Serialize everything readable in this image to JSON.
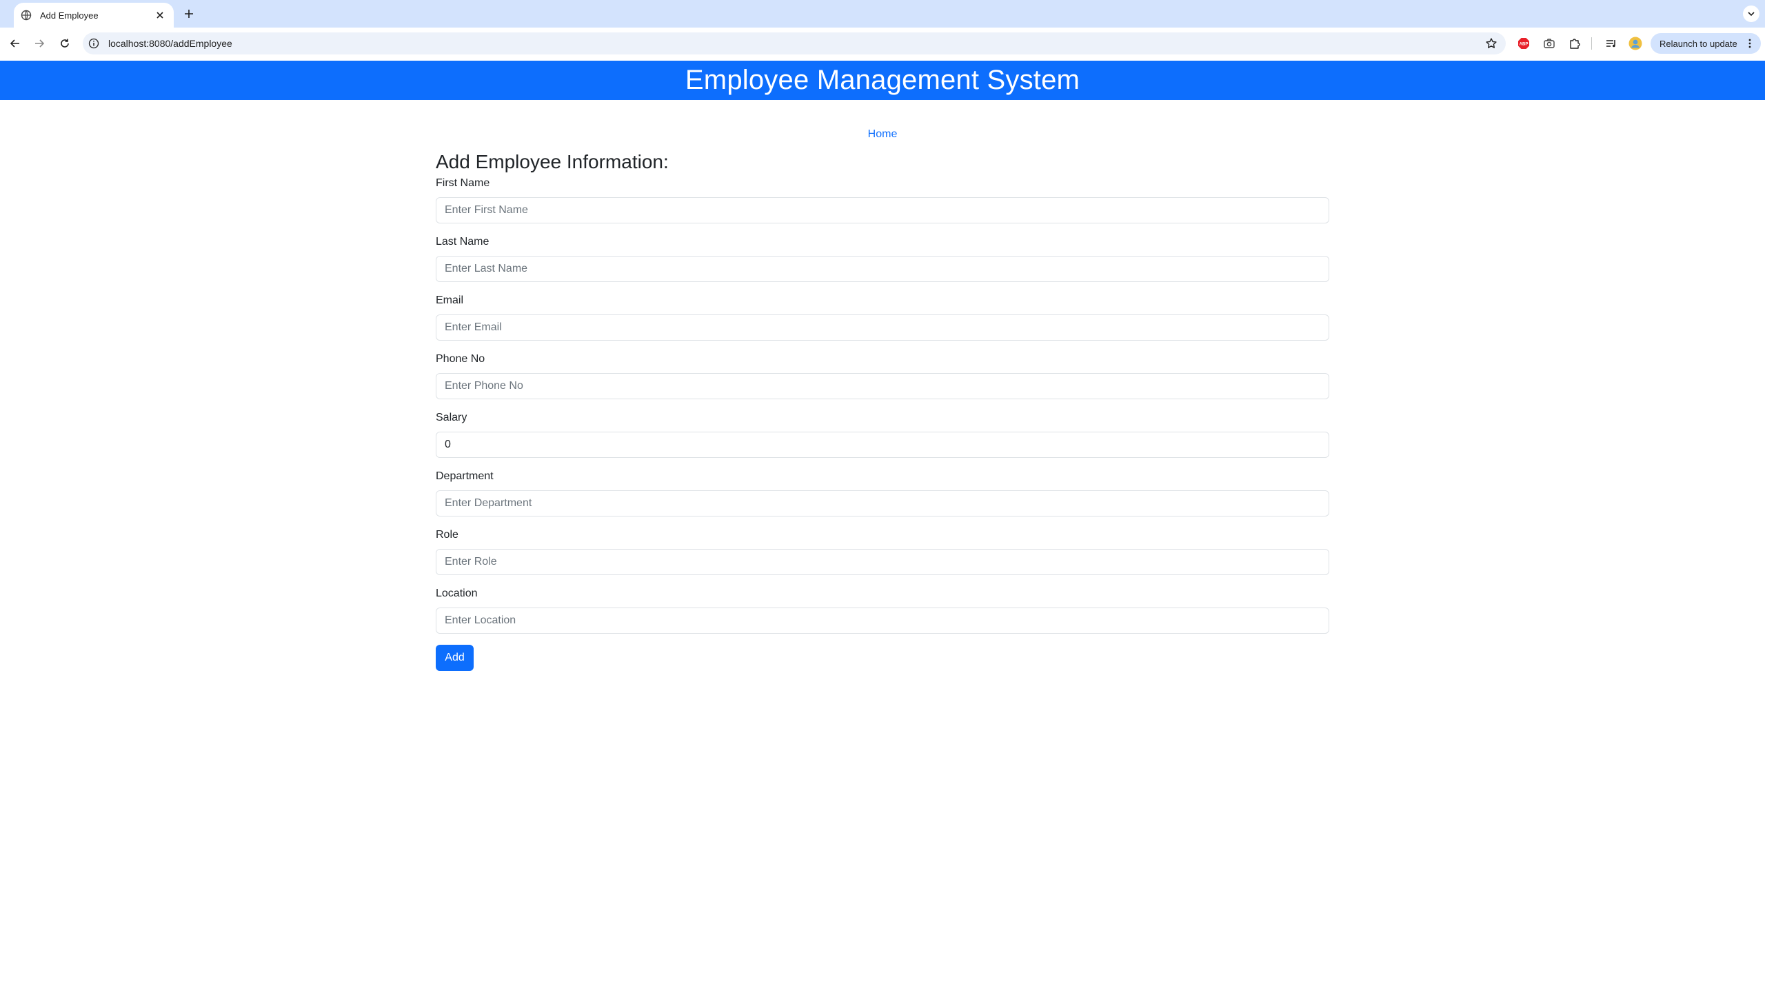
{
  "browser": {
    "tab_title": "Add Employee",
    "url": "localhost:8080/addEmployee",
    "relaunch_label": "Relaunch to update",
    "abp_label": "ABP"
  },
  "page": {
    "header_title": "Employee Management System",
    "home_link": "Home",
    "form_heading": "Add Employee Information:",
    "fields": [
      {
        "label": "First Name",
        "placeholder": "Enter First Name",
        "value": ""
      },
      {
        "label": "Last Name",
        "placeholder": "Enter Last Name",
        "value": ""
      },
      {
        "label": "Email",
        "placeholder": "Enter Email",
        "value": ""
      },
      {
        "label": "Phone No",
        "placeholder": "Enter Phone No",
        "value": ""
      },
      {
        "label": "Salary",
        "placeholder": "",
        "value": "0"
      },
      {
        "label": "Department",
        "placeholder": "Enter Department",
        "value": ""
      },
      {
        "label": "Role",
        "placeholder": "Enter Role",
        "value": ""
      },
      {
        "label": "Location",
        "placeholder": "Enter Location",
        "value": ""
      }
    ],
    "submit_label": "Add"
  },
  "colors": {
    "primary": "#0d6efd",
    "tabstrip": "#d3e3fd",
    "omnibox": "#edf2fa"
  }
}
